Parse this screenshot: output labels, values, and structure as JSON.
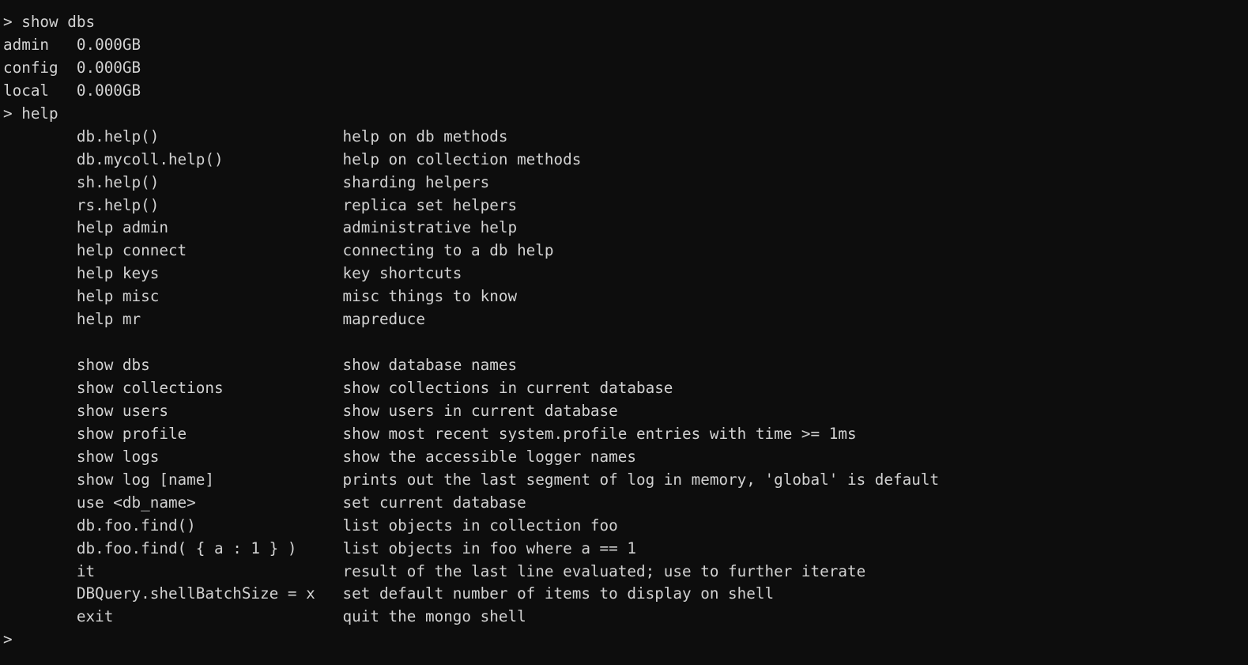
{
  "terminal": {
    "program": "mongo-shell",
    "prompt": ">",
    "colors": {
      "background": "#0d0d0d",
      "foreground": "#d2d2d2"
    },
    "lines": [
      "> show dbs",
      "admin   0.000GB",
      "config  0.000GB",
      "local   0.000GB",
      "> help",
      "        db.help()                    help on db methods",
      "        db.mycoll.help()             help on collection methods",
      "        sh.help()                    sharding helpers",
      "        rs.help()                    replica set helpers",
      "        help admin                   administrative help",
      "        help connect                 connecting to a db help",
      "        help keys                    key shortcuts",
      "        help misc                    misc things to know",
      "        help mr                      mapreduce",
      "",
      "        show dbs                     show database names",
      "        show collections             show collections in current database",
      "        show users                   show users in current database",
      "        show profile                 show most recent system.profile entries with time >= 1ms",
      "        show logs                    show the accessible logger names",
      "        show log [name]              prints out the last segment of log in memory, 'global' is default",
      "        use <db_name>                set current database",
      "        db.foo.find()                list objects in collection foo",
      "        db.foo.find( { a : 1 } )     list objects in foo where a == 1",
      "        it                           result of the last line evaluated; use to further iterate",
      "        DBQuery.shellBatchSize = x   set default number of items to display on shell",
      "        exit                         quit the mongo shell",
      ">"
    ],
    "commands_entered": [
      "show dbs",
      "help"
    ],
    "databases": [
      {
        "name": "admin",
        "size": "0.000GB"
      },
      {
        "name": "config",
        "size": "0.000GB"
      },
      {
        "name": "local",
        "size": "0.000GB"
      }
    ],
    "help_sections": [
      {
        "entries": [
          {
            "command": "db.help()",
            "description": "help on db methods"
          },
          {
            "command": "db.mycoll.help()",
            "description": "help on collection methods"
          },
          {
            "command": "sh.help()",
            "description": "sharding helpers"
          },
          {
            "command": "rs.help()",
            "description": "replica set helpers"
          },
          {
            "command": "help admin",
            "description": "administrative help"
          },
          {
            "command": "help connect",
            "description": "connecting to a db help"
          },
          {
            "command": "help keys",
            "description": "key shortcuts"
          },
          {
            "command": "help misc",
            "description": "misc things to know"
          },
          {
            "command": "help mr",
            "description": "mapreduce"
          }
        ]
      },
      {
        "entries": [
          {
            "command": "show dbs",
            "description": "show database names"
          },
          {
            "command": "show collections",
            "description": "show collections in current database"
          },
          {
            "command": "show users",
            "description": "show users in current database"
          },
          {
            "command": "show profile",
            "description": "show most recent system.profile entries with time >= 1ms"
          },
          {
            "command": "show logs",
            "description": "show the accessible logger names"
          },
          {
            "command": "show log [name]",
            "description": "prints out the last segment of log in memory, 'global' is default"
          },
          {
            "command": "use <db_name>",
            "description": "set current database"
          },
          {
            "command": "db.foo.find()",
            "description": "list objects in collection foo"
          },
          {
            "command": "db.foo.find( { a : 1 } )",
            "description": "list objects in foo where a == 1"
          },
          {
            "command": "it",
            "description": "result of the last line evaluated; use to further iterate"
          },
          {
            "command": "DBQuery.shellBatchSize = x",
            "description": "set default number of items to display on shell"
          },
          {
            "command": "exit",
            "description": "quit the mongo shell"
          }
        ]
      }
    ]
  }
}
